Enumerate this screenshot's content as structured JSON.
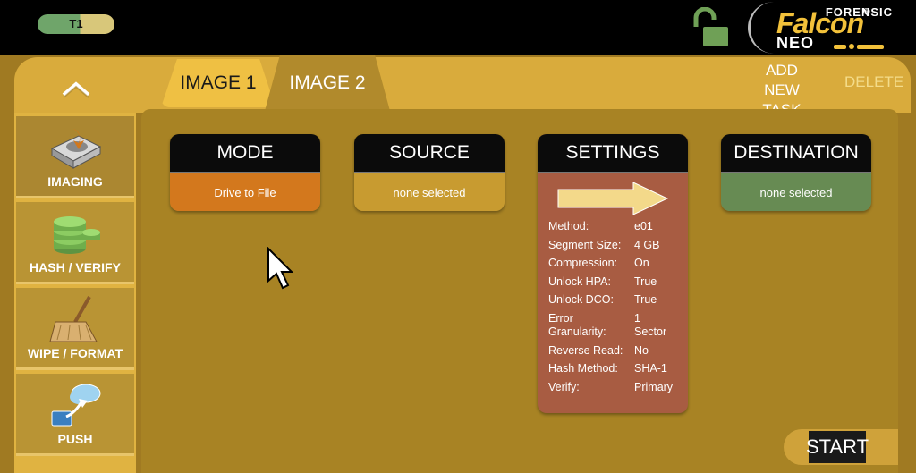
{
  "topbar": {
    "task_pill": "T1",
    "logo": {
      "forensic": "FORENSIC",
      "falcon": "Falcon",
      "neo": "NEO",
      "registered": "®"
    }
  },
  "tabs": [
    {
      "label": "IMAGE 1",
      "active": false
    },
    {
      "label": "IMAGE 2",
      "active": true
    }
  ],
  "header_actions": {
    "add_new_task": [
      "ADD NEW",
      "TASK"
    ],
    "delete": "DELETE"
  },
  "sidebar": {
    "items": [
      {
        "label": "IMAGING",
        "icon": "hard-drive-icon",
        "active": true
      },
      {
        "label": "HASH / VERIFY",
        "icon": "database-stack-icon",
        "active": false
      },
      {
        "label": "WIPE / FORMAT",
        "icon": "broom-icon",
        "active": false
      },
      {
        "label": "PUSH",
        "icon": "cloud-upload-icon",
        "active": false
      }
    ]
  },
  "cards": {
    "mode": {
      "title": "MODE",
      "value": "Drive to File"
    },
    "source": {
      "title": "SOURCE",
      "value": "none selected"
    },
    "settings": {
      "title": "SETTINGS",
      "rows": [
        {
          "key": "Method:",
          "value": "e01"
        },
        {
          "key": "Segment Size:",
          "value": "4 GB"
        },
        {
          "key": "Compression:",
          "value": "On"
        },
        {
          "key": "Unlock HPA:",
          "value": "True"
        },
        {
          "key": "Unlock DCO:",
          "value": "True"
        },
        {
          "key": "Error Granularity:",
          "value": "1 Sector"
        },
        {
          "key": "Reverse Read:",
          "value": "No"
        },
        {
          "key": "Hash Method:",
          "value": "SHA-1"
        },
        {
          "key": "Verify:",
          "value": "Primary"
        }
      ]
    },
    "destination": {
      "title": "DESTINATION",
      "value": "none selected"
    }
  },
  "start_button": "START",
  "colors": {
    "frame": "#a07a22",
    "header_band": "#d9ab3c",
    "mode_orange": "#d3781d",
    "source_gold": "#c89b30",
    "settings_red": "#a85c42",
    "dest_green": "#678b53",
    "logo_gold": "#f2c13a"
  }
}
